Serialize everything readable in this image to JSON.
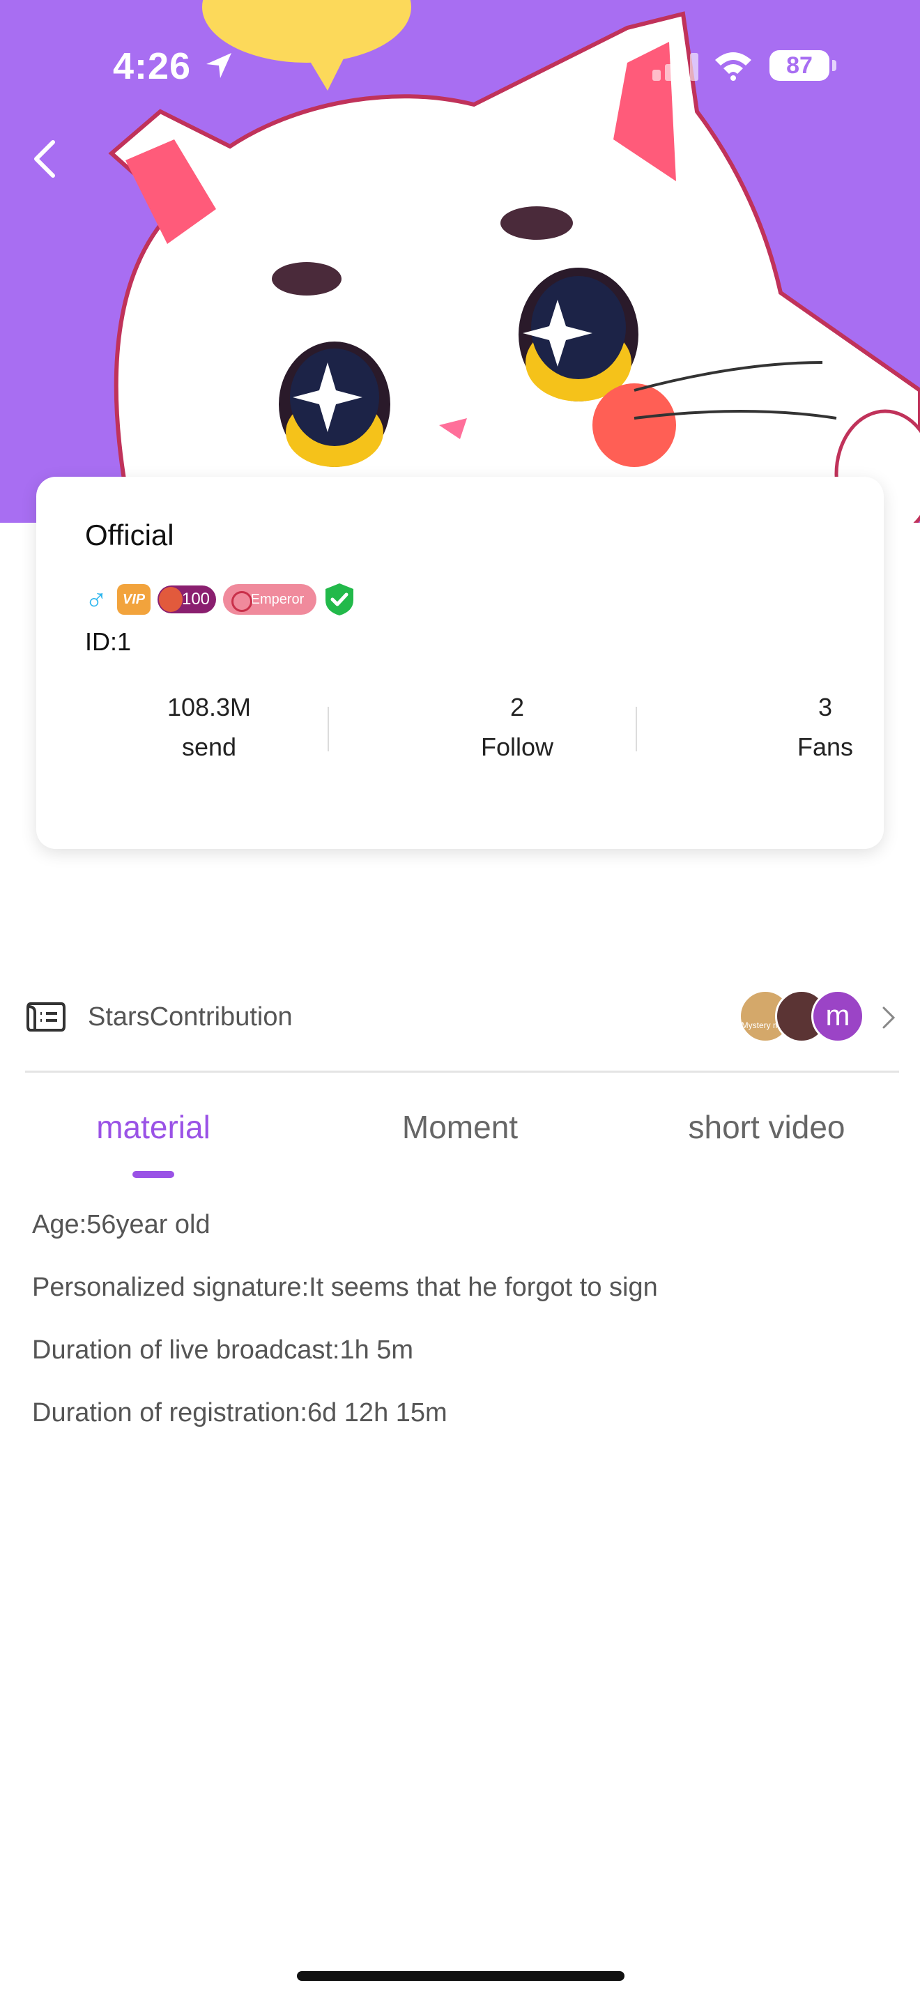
{
  "status_bar": {
    "time": "4:26",
    "battery": "87"
  },
  "profile": {
    "name": "Official",
    "id": "ID:1",
    "badges": {
      "gender": "♂",
      "vip": "VIP",
      "level": "100",
      "emperor": "Emperor"
    },
    "stats": [
      {
        "value": "108.3M",
        "label": "send"
      },
      {
        "value": "2",
        "label": "Follow"
      },
      {
        "value": "3",
        "label": "Fans"
      }
    ]
  },
  "contribution": {
    "label": "StarsContribution",
    "avatars": [
      {
        "text": "Mystery man"
      },
      {
        "text": ""
      },
      {
        "text": "m"
      }
    ]
  },
  "tabs": [
    {
      "label": "material",
      "active": true
    },
    {
      "label": "Moment",
      "active": false
    },
    {
      "label": "short video",
      "active": false
    }
  ],
  "material": {
    "age": "Age:56year old",
    "signature": "Personalized signature:It seems that he forgot to sign",
    "live_duration": "Duration of live broadcast:1h 5m",
    "registration_duration": "Duration of registration:6d 12h 15m"
  },
  "colors": {
    "banner": "#a86ef2",
    "accent": "#9a52e6"
  }
}
